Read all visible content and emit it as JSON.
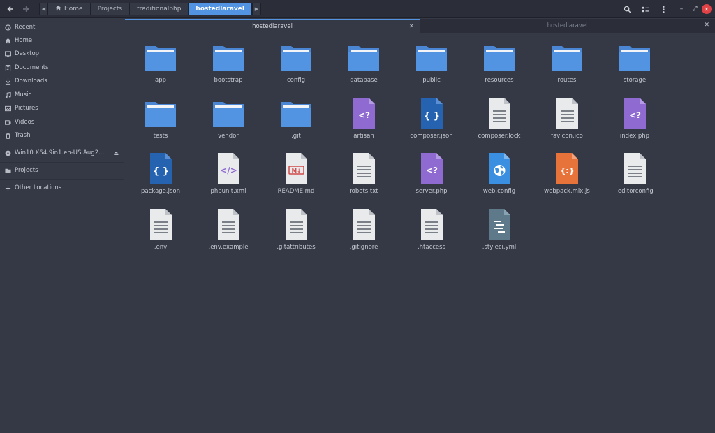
{
  "pathbar": {
    "crumbs": [
      "Home",
      "Projects",
      "traditionalphp",
      "hostedlaravel"
    ]
  },
  "sidebar": {
    "items": [
      "Recent",
      "Home",
      "Desktop",
      "Documents",
      "Downloads",
      "Music",
      "Pictures",
      "Videos",
      "Trash"
    ],
    "device": "Win10.X64.9in1.en-US.Aug2...",
    "bookmark": "Projects",
    "other": "Other Locations"
  },
  "tabs": [
    "hostedlaravel",
    "hostedlaravel"
  ],
  "files": [
    {
      "name": "app",
      "type": "folder"
    },
    {
      "name": "bootstrap",
      "type": "folder"
    },
    {
      "name": "config",
      "type": "folder"
    },
    {
      "name": "database",
      "type": "folder"
    },
    {
      "name": "public",
      "type": "folder"
    },
    {
      "name": "resources",
      "type": "folder"
    },
    {
      "name": "routes",
      "type": "folder"
    },
    {
      "name": "storage",
      "type": "folder"
    },
    {
      "name": "tests",
      "type": "folder"
    },
    {
      "name": "vendor",
      "type": "folder"
    },
    {
      "name": ".git",
      "type": "folder"
    },
    {
      "name": "artisan",
      "type": "php"
    },
    {
      "name": "composer.json",
      "type": "json"
    },
    {
      "name": "composer.lock",
      "type": "text"
    },
    {
      "name": "favicon.ico",
      "type": "text"
    },
    {
      "name": "index.php",
      "type": "php"
    },
    {
      "name": "package.json",
      "type": "json"
    },
    {
      "name": "phpunit.xml",
      "type": "xml"
    },
    {
      "name": "README.md",
      "type": "markdown"
    },
    {
      "name": "robots.txt",
      "type": "text"
    },
    {
      "name": "server.php",
      "type": "php"
    },
    {
      "name": "web.config",
      "type": "web"
    },
    {
      "name": "webpack.mix.js",
      "type": "js"
    },
    {
      "name": ".editorconfig",
      "type": "text"
    },
    {
      "name": ".env",
      "type": "text"
    },
    {
      "name": ".env.example",
      "type": "text"
    },
    {
      "name": ".gitattributes",
      "type": "text"
    },
    {
      "name": ".gitignore",
      "type": "text"
    },
    {
      "name": ".htaccess",
      "type": "text"
    },
    {
      "name": ".styleci.yml",
      "type": "yaml"
    }
  ],
  "colors": {
    "accent": "#5294e2",
    "folder": "#5294e2",
    "php": "#8f6bd1",
    "json": "#2563b0",
    "js": "#e8733a",
    "yaml": "#5e7a8a",
    "close": "#e14245"
  }
}
